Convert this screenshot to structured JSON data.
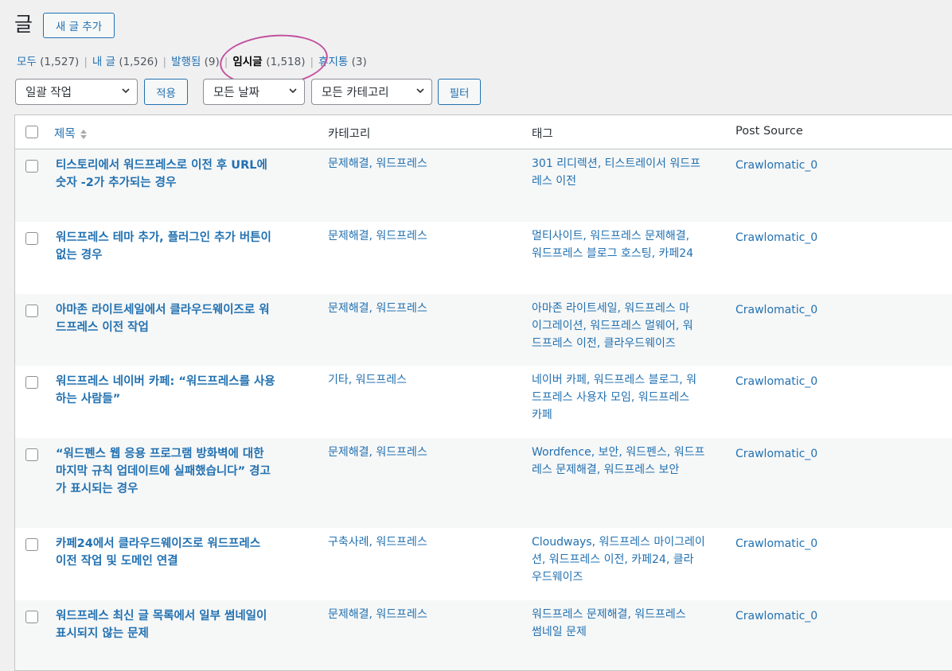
{
  "header": {
    "title": "글",
    "add_new": "새 글 추가"
  },
  "filters": {
    "all": "모두",
    "all_count": "(1,527)",
    "mine": "내 글",
    "mine_count": "(1,526)",
    "published": "발행됨",
    "published_count": "(9)",
    "drafts": "임시글",
    "drafts_count": "(1,518)",
    "trash": "휴지통",
    "trash_count": "(3)",
    "sep": "|"
  },
  "toolbar": {
    "bulk_action": "일괄 작업",
    "apply": "적용",
    "date_filter": "모든 날짜",
    "category_filter": "모든 카테고리",
    "filter": "필터"
  },
  "columns": {
    "title": "제목",
    "categories": "카테고리",
    "tags": "태그",
    "source": "Post Source"
  },
  "rows": [
    {
      "title": [
        "티스토리에서 워드프레스로 이전 후 URL에",
        "숫자 -2가 추가되는 경우"
      ],
      "categories": "문제해결, 워드프레스",
      "tags": [
        "301 리디렉션, 티스트레이서 워드프",
        "레스 이전"
      ],
      "source": "Crawlomatic_0"
    },
    {
      "title": [
        "워드프레스 테마 추가, 플러그인 추가 버튼이",
        "없는 경우"
      ],
      "categories": "문제해결, 워드프레스",
      "tags": [
        "멀티사이트, 워드프레스 문제해결,",
        "워드프레스 블로그 호스팅, 카페24"
      ],
      "source": "Crawlomatic_0"
    },
    {
      "title": [
        "아마존 라이트세일에서 클라우드웨이즈로 워",
        "드프레스 이전 작업"
      ],
      "categories": "문제해결, 워드프레스",
      "tags": [
        "아마존 라이트세일, 워드프레스 마",
        "이그레이션, 워드프레스 멀웨어, 워",
        "드프레스 이전, 클라우드웨이즈"
      ],
      "source": "Crawlomatic_0"
    },
    {
      "title": [
        "워드프레스 네이버 카페: “워드프레스를 사용",
        "하는 사람들”"
      ],
      "categories": "기타, 워드프레스",
      "tags": [
        "네이버 카페, 워드프레스 블로그, 워",
        "드프레스 사용자 모임, 워드프레스",
        "카페"
      ],
      "source": "Crawlomatic_0"
    },
    {
      "title": [
        "“워드펜스 웹 응용 프로그램 방화벽에 대한",
        "마지막 규칙 업데이트에 실패했습니다” 경고",
        "가 표시되는 경우"
      ],
      "categories": "문제해결, 워드프레스",
      "tags": [
        "Wordfence, 보안, 워드펜스, 워드프",
        "레스 문제해결, 워드프레스 보안"
      ],
      "source": "Crawlomatic_0"
    },
    {
      "title": [
        "카페24에서 클라우드웨이즈로 워드프레스",
        "이전 작업 및 도메인 연결"
      ],
      "categories": "구축사례, 워드프레스",
      "tags": [
        "Cloudways, 워드프레스 마이그레이",
        "션, 워드프레스 이전, 카페24, 클라",
        "우드웨이즈"
      ],
      "source": "Crawlomatic_0"
    },
    {
      "title": [
        "워드프레스 최신 글 목록에서 일부 썸네일이",
        "표시되지 않는 문제"
      ],
      "categories": "문제해결, 워드프레스",
      "tags": [
        "워드프레스 문제해결, 워드프레스",
        "썸네일 문제"
      ],
      "source": "Crawlomatic_0"
    }
  ]
}
